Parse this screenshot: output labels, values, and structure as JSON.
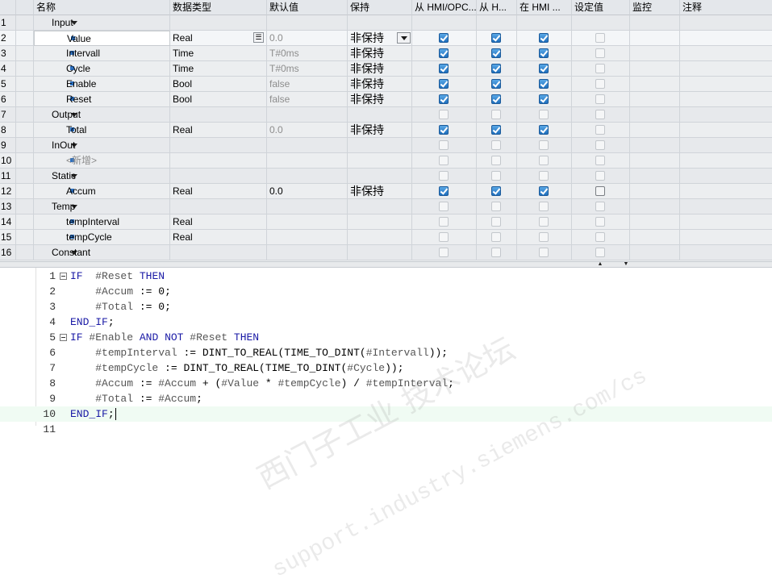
{
  "columns": {
    "name": "名称",
    "datatype": "数据类型",
    "default": "默认值",
    "retain": "保持",
    "hmi_opc": "从 HMI/OPC...",
    "hmi_visible": "从 H...",
    "hmi_in": "在 HMI ...",
    "setpoint": "设定值",
    "monitor": "监控",
    "comment": "注释"
  },
  "rows": [
    {
      "num": "1",
      "kind": "section",
      "name": "Input",
      "type": "",
      "default": "",
      "retain": "",
      "c1": null,
      "c2": null,
      "c3": null,
      "sp": null
    },
    {
      "num": "2",
      "kind": "var",
      "name": "Value",
      "type": "Real",
      "default": "0.0",
      "default_gray": true,
      "retain": "非保持",
      "c1": true,
      "c2": true,
      "c3": true,
      "sp": false,
      "selected": true
    },
    {
      "num": "3",
      "kind": "var",
      "name": "Intervall",
      "type": "Time",
      "default": "T#0ms",
      "default_gray": true,
      "retain": "非保持",
      "c1": true,
      "c2": true,
      "c3": true,
      "sp": false
    },
    {
      "num": "4",
      "kind": "var",
      "name": "Cycle",
      "type": "Time",
      "default": "T#0ms",
      "default_gray": true,
      "retain": "非保持",
      "c1": true,
      "c2": true,
      "c3": true,
      "sp": false
    },
    {
      "num": "5",
      "kind": "var",
      "name": "Enable",
      "type": "Bool",
      "default": "false",
      "default_gray": true,
      "retain": "非保持",
      "c1": true,
      "c2": true,
      "c3": true,
      "sp": false
    },
    {
      "num": "6",
      "kind": "var",
      "name": "Reset",
      "type": "Bool",
      "default": "false",
      "default_gray": true,
      "retain": "非保持",
      "c1": true,
      "c2": true,
      "c3": true,
      "sp": false
    },
    {
      "num": "7",
      "kind": "section",
      "name": "Output",
      "type": "",
      "default": "",
      "retain": "",
      "c1": false,
      "c2": false,
      "c3": false,
      "sp": false
    },
    {
      "num": "8",
      "kind": "var",
      "name": "Total",
      "type": "Real",
      "default": "0.0",
      "default_gray": true,
      "retain": "非保持",
      "c1": true,
      "c2": true,
      "c3": true,
      "sp": false
    },
    {
      "num": "9",
      "kind": "section",
      "name": "InOut",
      "type": "",
      "default": "",
      "retain": "",
      "c1": false,
      "c2": false,
      "c3": false,
      "sp": false
    },
    {
      "num": "10",
      "kind": "new",
      "name": "<新增>",
      "type": "",
      "default": "",
      "retain": "",
      "c1": false,
      "c2": false,
      "c3": false,
      "sp": false
    },
    {
      "num": "11",
      "kind": "section",
      "name": "Static",
      "type": "",
      "default": "",
      "retain": "",
      "c1": false,
      "c2": false,
      "c3": false,
      "sp": false
    },
    {
      "num": "12",
      "kind": "var",
      "name": "Accum",
      "type": "Real",
      "default": "0.0",
      "default_gray": false,
      "retain": "非保持",
      "c1": true,
      "c2": true,
      "c3": true,
      "sp": "dark"
    },
    {
      "num": "13",
      "kind": "section",
      "name": "Temp",
      "type": "",
      "default": "",
      "retain": "",
      "c1": false,
      "c2": false,
      "c3": false,
      "sp": false
    },
    {
      "num": "14",
      "kind": "var",
      "name": "tempInterval",
      "type": "Real",
      "default": "",
      "default_gray": false,
      "retain": "",
      "c1": false,
      "c2": false,
      "c3": false,
      "sp": false
    },
    {
      "num": "15",
      "kind": "var",
      "name": "tempCycle",
      "type": "Real",
      "default": "",
      "default_gray": false,
      "retain": "",
      "c1": false,
      "c2": false,
      "c3": false,
      "sp": false
    },
    {
      "num": "16",
      "kind": "section",
      "name": "Constant",
      "type": "",
      "default": "",
      "retain": "",
      "c1": false,
      "c2": false,
      "c3": false,
      "sp": false
    }
  ],
  "splitter": {
    "up": "▲",
    "down": "▼"
  },
  "code_lines": [
    {
      "num": "1",
      "fold": true,
      "tokens": [
        [
          "kw",
          "IF"
        ],
        [
          "t",
          "  "
        ],
        [
          "var",
          "#Reset"
        ],
        [
          "t",
          " "
        ],
        [
          "kw",
          "THEN"
        ]
      ]
    },
    {
      "num": "2",
      "fold": false,
      "tokens": [
        [
          "t",
          "    "
        ],
        [
          "var",
          "#Accum"
        ],
        [
          "t",
          " := "
        ],
        [
          "t",
          "0"
        ],
        [
          "t",
          ";"
        ]
      ]
    },
    {
      "num": "3",
      "fold": false,
      "tokens": [
        [
          "t",
          "    "
        ],
        [
          "var",
          "#Total"
        ],
        [
          "t",
          " := "
        ],
        [
          "t",
          "0"
        ],
        [
          "t",
          ";"
        ]
      ]
    },
    {
      "num": "4",
      "fold": false,
      "tokens": [
        [
          "kw",
          "END_IF"
        ],
        [
          "t",
          ";"
        ]
      ]
    },
    {
      "num": "5",
      "fold": true,
      "tokens": [
        [
          "kw",
          "IF"
        ],
        [
          "t",
          " "
        ],
        [
          "var",
          "#Enable"
        ],
        [
          "t",
          " "
        ],
        [
          "kw",
          "AND"
        ],
        [
          "t",
          " "
        ],
        [
          "kw",
          "NOT"
        ],
        [
          "t",
          " "
        ],
        [
          "var",
          "#Reset"
        ],
        [
          "t",
          " "
        ],
        [
          "kw",
          "THEN"
        ]
      ]
    },
    {
      "num": "6",
      "fold": false,
      "tokens": [
        [
          "t",
          "    "
        ],
        [
          "var",
          "#tempInterval"
        ],
        [
          "t",
          " := DINT_TO_REAL(TIME_TO_DINT("
        ],
        [
          "var",
          "#Intervall"
        ],
        [
          "t",
          "));"
        ]
      ]
    },
    {
      "num": "7",
      "fold": false,
      "tokens": [
        [
          "t",
          "    "
        ],
        [
          "var",
          "#tempCycle"
        ],
        [
          "t",
          " := DINT_TO_REAL(TIME_TO_DINT("
        ],
        [
          "var",
          "#Cycle"
        ],
        [
          "t",
          "));"
        ]
      ]
    },
    {
      "num": "8",
      "fold": false,
      "tokens": [
        [
          "t",
          "    "
        ],
        [
          "var",
          "#Accum"
        ],
        [
          "t",
          " := "
        ],
        [
          "var",
          "#Accum"
        ],
        [
          "t",
          " + ("
        ],
        [
          "var",
          "#Value"
        ],
        [
          "t",
          " * "
        ],
        [
          "var",
          "#tempCycle"
        ],
        [
          "t",
          ") / "
        ],
        [
          "var",
          "#tempInterval"
        ],
        [
          "t",
          ";"
        ]
      ]
    },
    {
      "num": "9",
      "fold": false,
      "tokens": [
        [
          "t",
          "    "
        ],
        [
          "var",
          "#Total"
        ],
        [
          "t",
          " := "
        ],
        [
          "var",
          "#Accum"
        ],
        [
          "t",
          ";"
        ]
      ]
    },
    {
      "num": "10",
      "fold": false,
      "current": true,
      "tokens": [
        [
          "kw",
          "END_IF"
        ],
        [
          "t",
          ";"
        ]
      ]
    },
    {
      "num": "11",
      "fold": false,
      "tokens": []
    }
  ],
  "watermark": {
    "line1": "西门子工业 技术论坛",
    "line2": "support.industry.siemens.com/cs"
  }
}
